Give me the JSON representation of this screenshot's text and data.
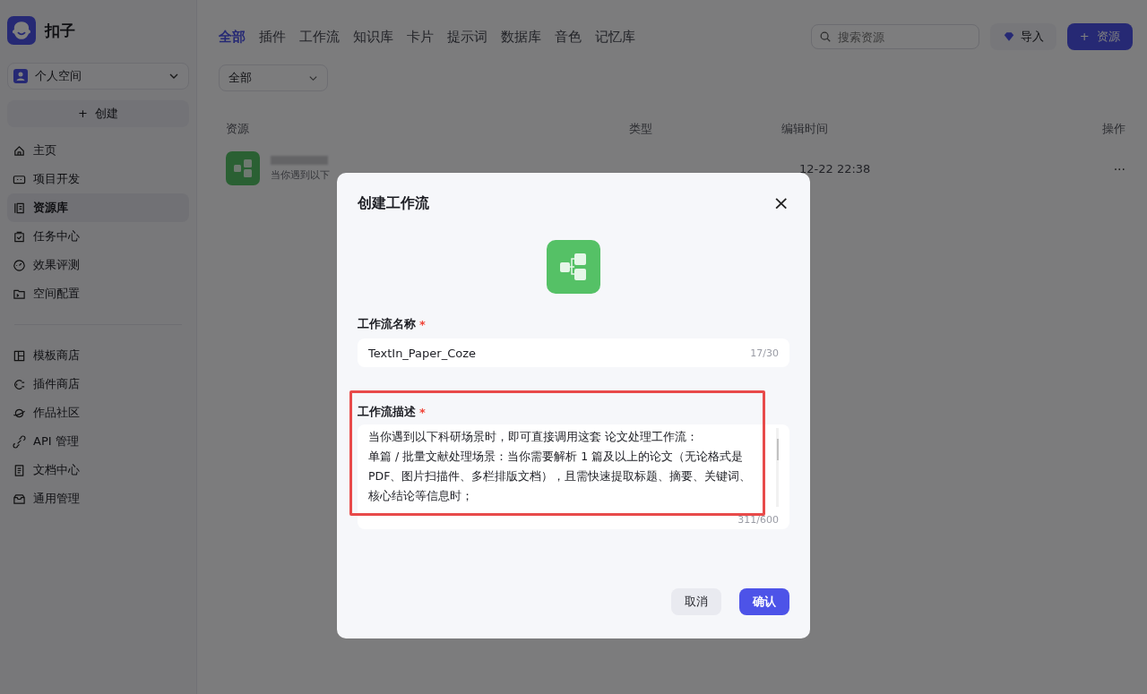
{
  "app": {
    "name": "扣子"
  },
  "workspace": {
    "label": "个人空间"
  },
  "create_button": {
    "icon": "+",
    "label": "创建"
  },
  "sidebar": {
    "groups": [
      [
        {
          "label": "主页",
          "selected": false
        },
        {
          "label": "项目开发",
          "selected": false
        },
        {
          "label": "资源库",
          "selected": true
        },
        {
          "label": "任务中心",
          "selected": false
        },
        {
          "label": "效果评测",
          "selected": false
        },
        {
          "label": "空间配置",
          "selected": false
        }
      ],
      [
        {
          "label": "模板商店",
          "selected": false
        },
        {
          "label": "插件商店",
          "selected": false
        },
        {
          "label": "作品社区",
          "selected": false
        },
        {
          "label": "API 管理",
          "selected": false
        },
        {
          "label": "文档中心",
          "selected": false
        },
        {
          "label": "通用管理",
          "selected": false
        }
      ]
    ]
  },
  "tabs": [
    {
      "label": "全部",
      "selected": true
    },
    {
      "label": "插件",
      "selected": false
    },
    {
      "label": "工作流",
      "selected": false
    },
    {
      "label": "知识库",
      "selected": false
    },
    {
      "label": "卡片",
      "selected": false
    },
    {
      "label": "提示词",
      "selected": false
    },
    {
      "label": "数据库",
      "selected": false
    },
    {
      "label": "音色",
      "selected": false
    },
    {
      "label": "记忆库",
      "selected": false
    }
  ],
  "search": {
    "placeholder": "搜索资源"
  },
  "import_button": {
    "label": "导入"
  },
  "add_button": {
    "icon": "+",
    "label": "资源"
  },
  "filter": {
    "value": "全部"
  },
  "table": {
    "columns": [
      "资源",
      "类型",
      "编辑时间",
      "操作"
    ],
    "rows": [
      {
        "description": "当你遇到以下",
        "edited": "12-22 22:38",
        "menu": "···"
      }
    ]
  },
  "dialog": {
    "title": "创建工作流",
    "close": "×",
    "name_field": {
      "label": "工作流名称",
      "required_mark": "*",
      "value": "TextIn_Paper_Coze",
      "counter": "17/30"
    },
    "description_field": {
      "label": "工作流描述",
      "required_mark": "*",
      "paragraphs": [
        "当你遇到以下科研场景时，即可直接调用这套 论文处理工作流：",
        "单篇 / 批量文献处理场景：当你需要解析 1 篇及以上的论文（无论格式是PDF、图片扫描件、多栏排版文档），且需快速提取标题、摘要、关键词、核心结论等信息时；"
      ],
      "counter": "311/600"
    },
    "buttons": [
      {
        "label": "取消",
        "kind": "secondary"
      },
      {
        "label": "确认",
        "kind": "primary"
      }
    ]
  }
}
